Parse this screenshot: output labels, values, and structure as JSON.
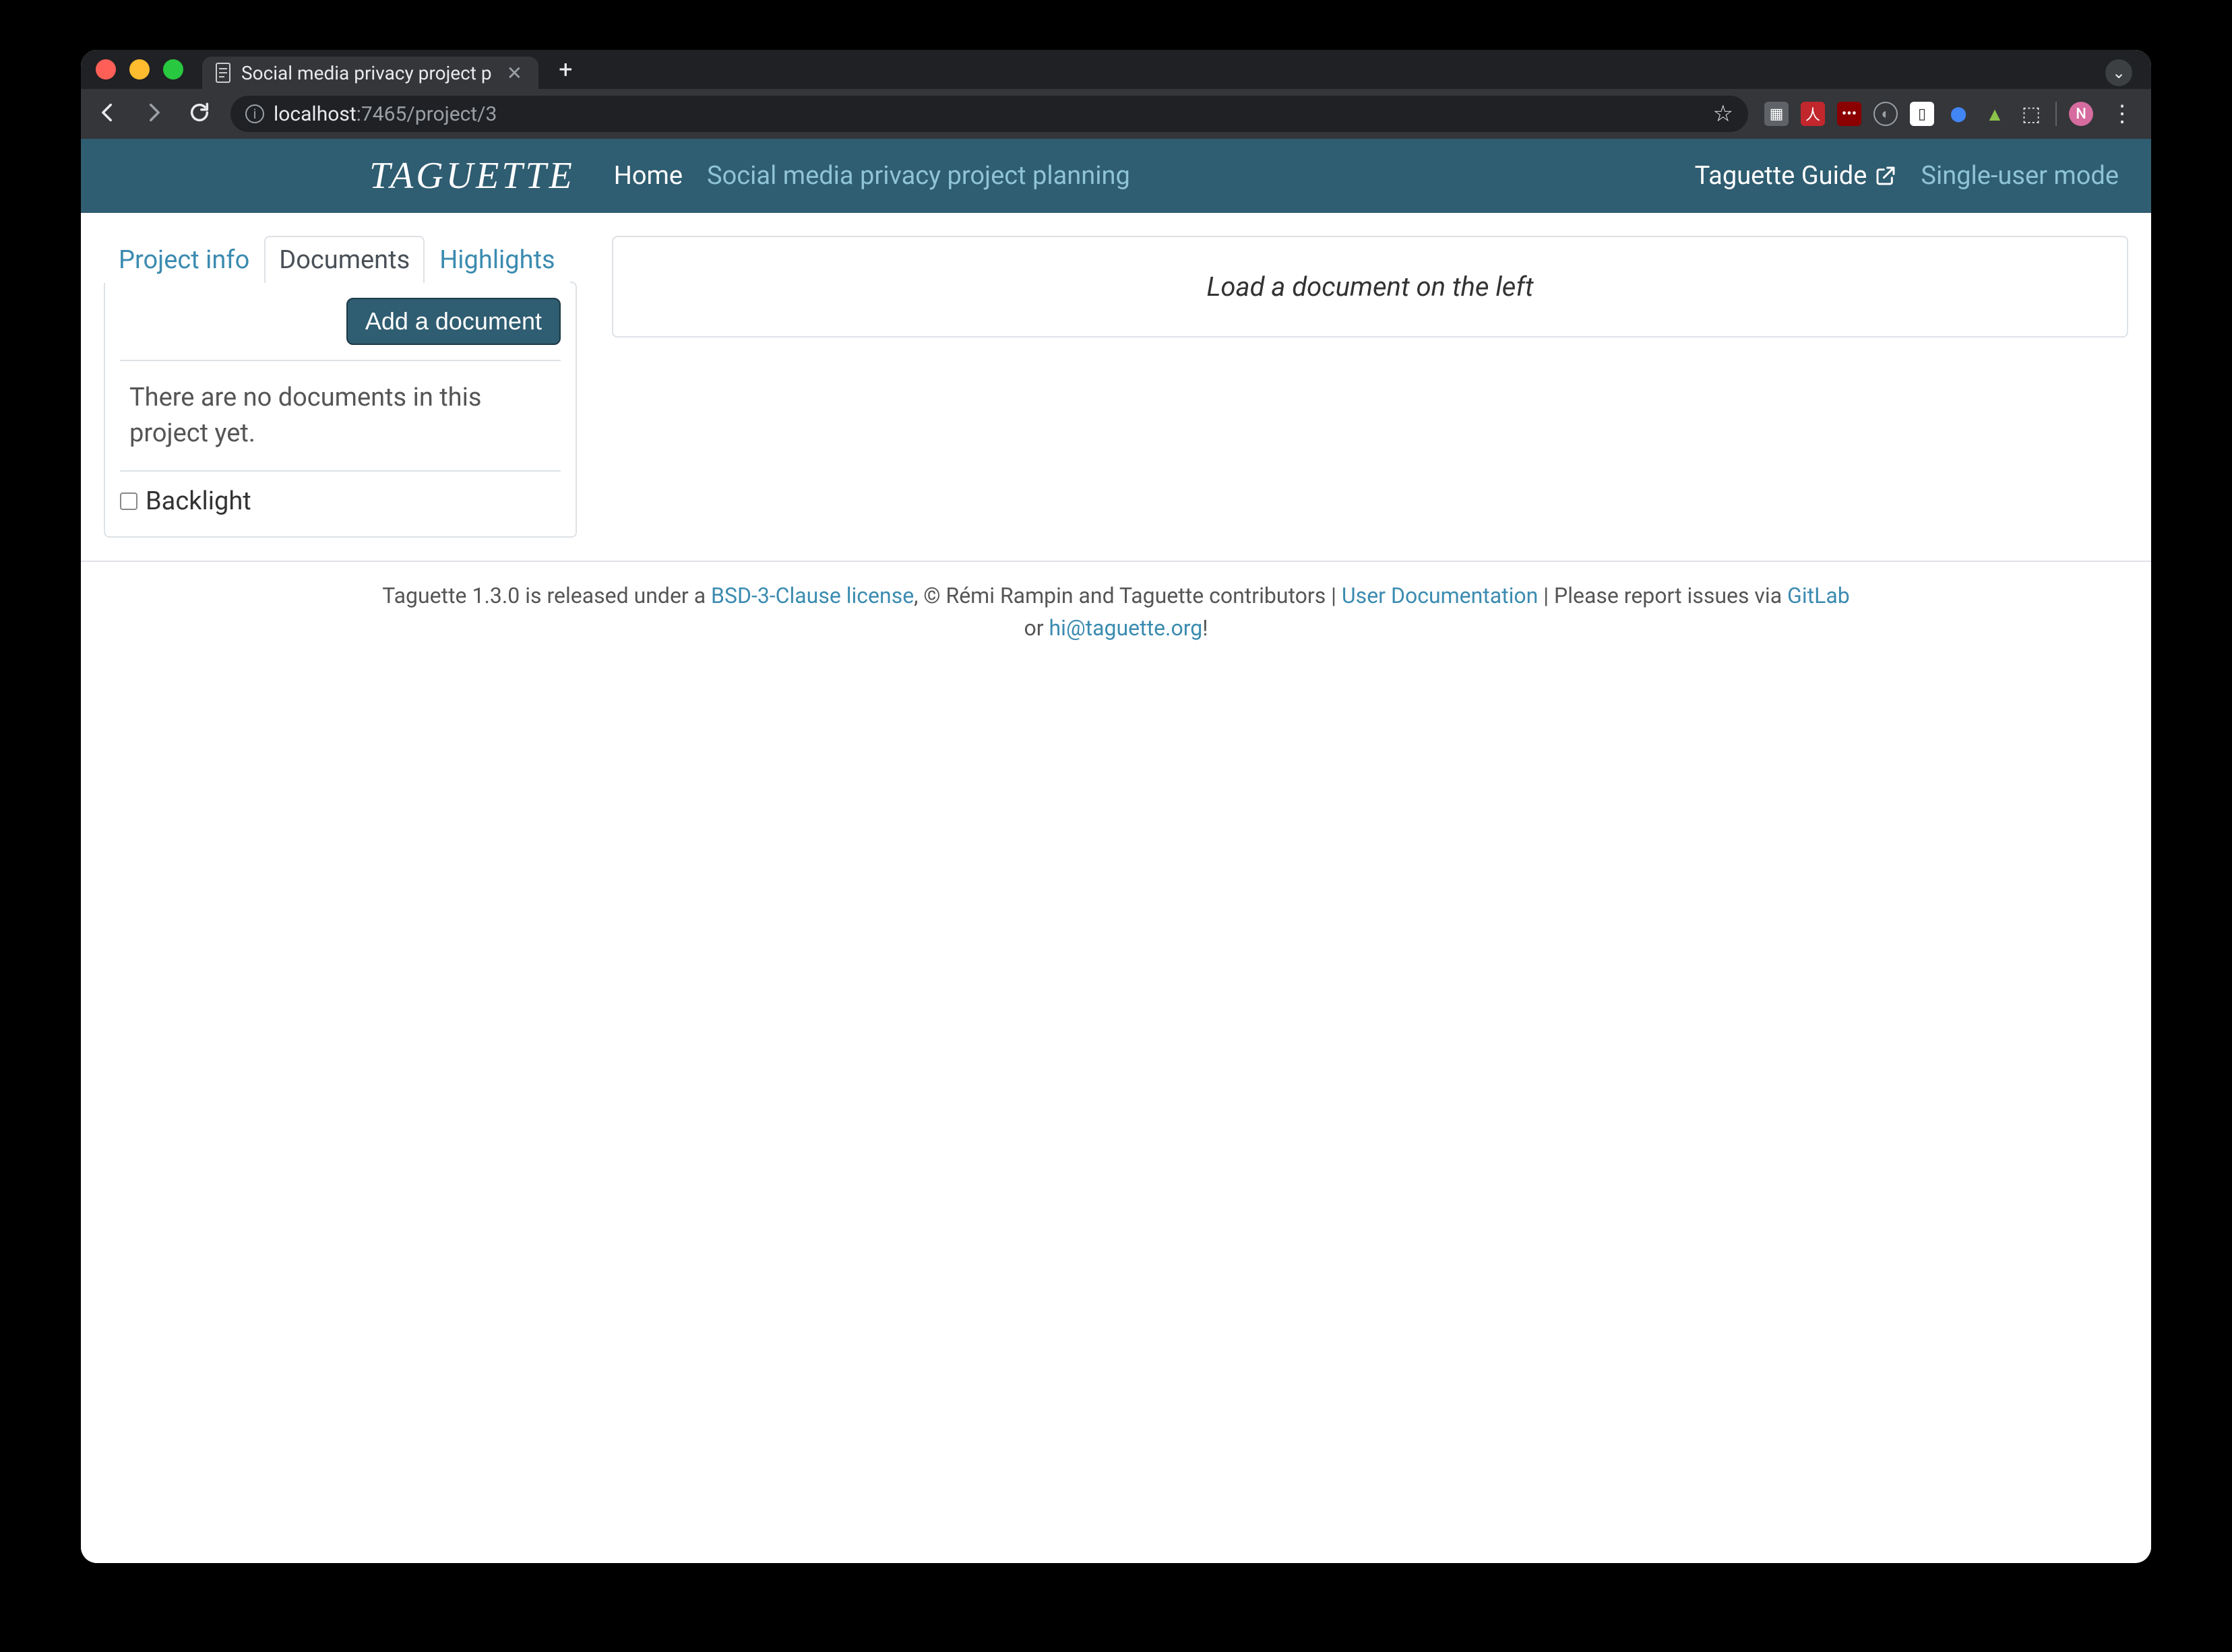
{
  "browser": {
    "tab_title": "Social media privacy project p",
    "url_host": "localhost",
    "url_port_path": ":7465/project/3",
    "profile_initial": "N"
  },
  "navbar": {
    "brand": "TAGUETTE",
    "home": "Home",
    "project_name": "Social media privacy project planning",
    "guide": "Taguette Guide",
    "mode": "Single-user mode"
  },
  "tabs": {
    "project_info": "Project info",
    "documents": "Documents",
    "highlights": "Highlights"
  },
  "sidebar": {
    "add_document": "Add a document",
    "empty_msg": "There are no documents in this project yet.",
    "backlight_label": "Backlight"
  },
  "main": {
    "hint": "Load a document on the left"
  },
  "footer": {
    "pre": "Taguette 1.3.0 is released under a ",
    "license": "BSD-3-Clause license",
    "mid1": ", © Rémi Rampin and Taguette contributors | ",
    "user_docs": "User Documentation",
    "mid2": " | Please report issues via ",
    "gitlab": "GitLab",
    "or": " or ",
    "email": "hi@taguette.org",
    "end": "!"
  }
}
